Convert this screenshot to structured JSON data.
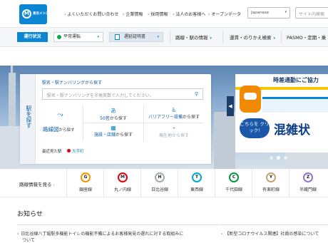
{
  "header": {
    "logo_mark": "M",
    "logo_text": "東京メトロ",
    "links": [
      "よくいただくお問い合わせ",
      "企業情報",
      "採用情報",
      "法人のお客様へ",
      "オープンデータ"
    ],
    "language": "Japanese",
    "search_placeholder": "サイト内検索"
  },
  "nav": {
    "status_button": "運行状況",
    "status_normal": "平常運転",
    "delay_cert": "遅延証明書",
    "menus": [
      "路線・駅の情報",
      "運賃・のりかえ検索",
      "PASMO・定期・乗"
    ]
  },
  "station_search": {
    "side_label": "駅を探す",
    "title": "駅名・駅ナンバリングから探す",
    "input_placeholder": "駅名・駅ナンバリングを半角英数で入力してください。",
    "route_map_label": "路線図",
    "route_map_suffix": "から探す",
    "options": [
      {
        "label": "50音",
        "suffix": "から探す",
        "icon": "あ"
      },
      {
        "label": "バリアフリー設備",
        "suffix": "から探す",
        "icon": "♿"
      },
      {
        "label": "施設・店舗",
        "suffix": "から探す",
        "icon": "▦"
      },
      {
        "label": "現在地",
        "suffix": "から探す",
        "icon": "⌖"
      }
    ],
    "recent_label": "最近見た駅",
    "recent_station": "大手町"
  },
  "banner": {
    "title": "時差通勤にご協力",
    "cta": "こちらを クリック!",
    "big_text": "混雑状"
  },
  "lines": {
    "label": "路線情報を見る",
    "items": [
      {
        "code": "G",
        "name": "銀座線",
        "color": "#f39700"
      },
      {
        "code": "M",
        "name": "丸ノ内線",
        "color": "#e60012"
      },
      {
        "code": "H",
        "name": "日比谷線",
        "color": "#9caeb7"
      },
      {
        "code": "T",
        "name": "東西線",
        "color": "#00a7db"
      },
      {
        "code": "C",
        "name": "千代田線",
        "color": "#009944"
      },
      {
        "code": "Y",
        "name": "有楽町線",
        "color": "#c1a470"
      },
      {
        "code": "Z",
        "name": "半蔵門線",
        "color": "#8f76d6"
      }
    ]
  },
  "news": {
    "title": "お知らせ",
    "items": [
      "日比谷線八丁堀駅多機能トイレの機能不備によるお客様発見の遅れに対する取組みに",
      "ついて",
      "【新型コロナウイルス関連】社員の感染について"
    ]
  }
}
